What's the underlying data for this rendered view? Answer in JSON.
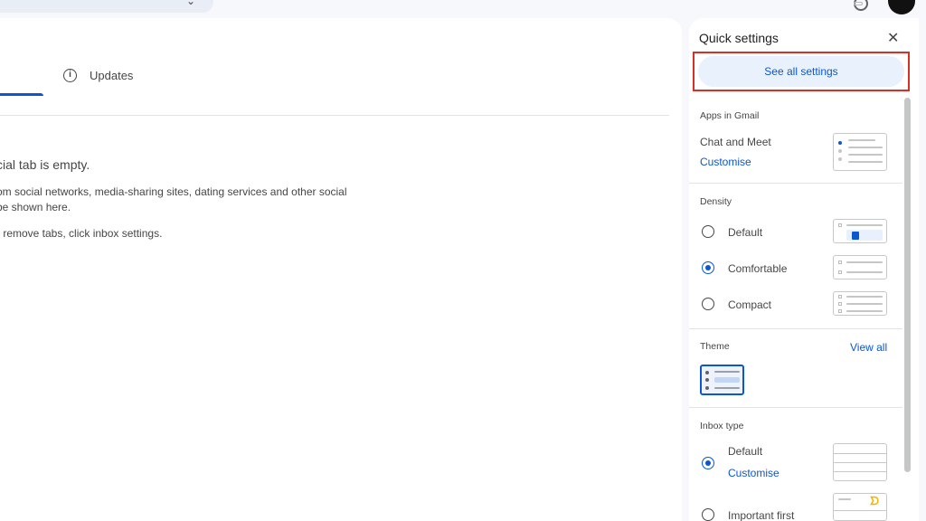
{
  "main": {
    "tab_updates": "Updates",
    "empty_title": "cial tab is empty.",
    "empty_desc_line1": "om social networks, media-sharing sites, dating services and other social",
    "empty_desc_line2": "be shown here.",
    "empty_hint": "r remove tabs, click inbox settings."
  },
  "quick_settings": {
    "title": "Quick settings",
    "see_all": "See all settings",
    "apps": {
      "section": "Apps in Gmail",
      "item": "Chat and Meet",
      "customise": "Customise"
    },
    "density": {
      "section": "Density",
      "options": [
        {
          "label": "Default",
          "checked": false
        },
        {
          "label": "Comfortable",
          "checked": true
        },
        {
          "label": "Compact",
          "checked": false
        }
      ]
    },
    "theme": {
      "section": "Theme",
      "view_all": "View all"
    },
    "inbox_type": {
      "section": "Inbox type",
      "options": [
        {
          "label": "Default",
          "checked": true,
          "customise": "Customise"
        },
        {
          "label": "Important first",
          "checked": false
        }
      ]
    }
  },
  "colors": {
    "accent": "#0b57d0",
    "highlight": "#d93025"
  },
  "icons": [
    "close-icon",
    "info-icon"
  ]
}
